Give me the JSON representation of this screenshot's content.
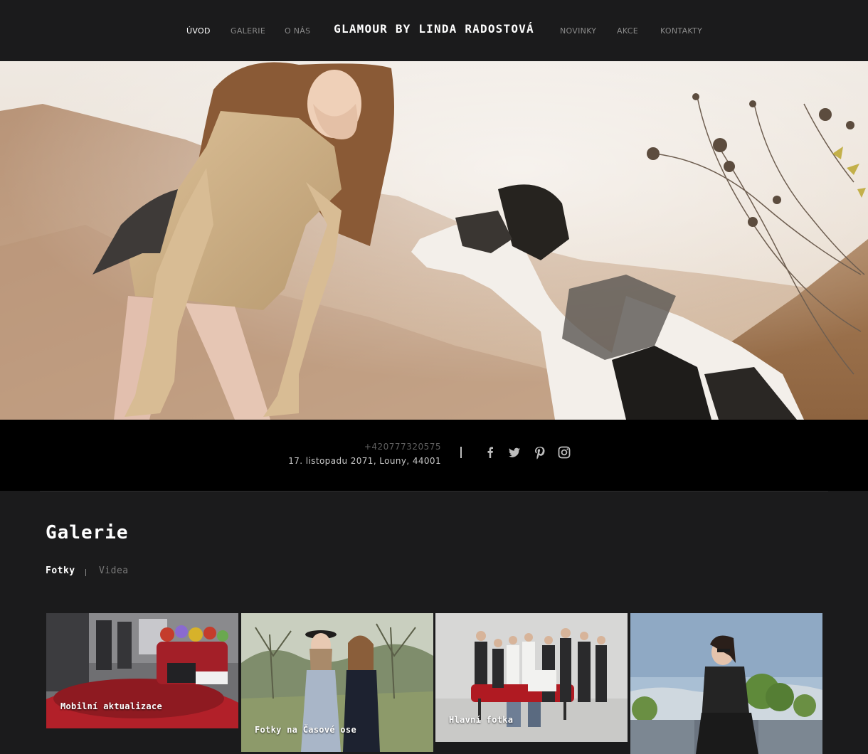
{
  "header": {
    "brand": "GLAMOUR BY LINDA RADOSTOVÁ",
    "nav_left": [
      {
        "label": "ÚVOD",
        "active": true
      },
      {
        "label": "GALERIE",
        "active": false
      },
      {
        "label": "O NÁS",
        "active": false
      }
    ],
    "nav_right": [
      {
        "label": "NOVINKY",
        "active": false
      },
      {
        "label": "AKCE",
        "active": false
      },
      {
        "label": "KONTAKTY",
        "active": false
      }
    ]
  },
  "contact": {
    "phone": "+420777320575",
    "address": "17. listopadu 2071, Louny, 44001",
    "social": [
      "facebook-icon",
      "twitter-icon",
      "pinterest-icon",
      "instagram-icon"
    ]
  },
  "gallery": {
    "title": "Galerie",
    "filters": {
      "active": "Fotky",
      "inactive": "Videa"
    },
    "tiles": [
      {
        "label": "Mobilní aktualizace"
      },
      {
        "label": "Fotky na Časové ose"
      },
      {
        "label": "Hlavní fotka"
      },
      {
        "label": ""
      }
    ]
  },
  "colors": {
    "background": "#1b1b1c",
    "contact_band": "#000000",
    "nav_inactive": "#8a8a8a",
    "text_primary": "#ffffff"
  }
}
